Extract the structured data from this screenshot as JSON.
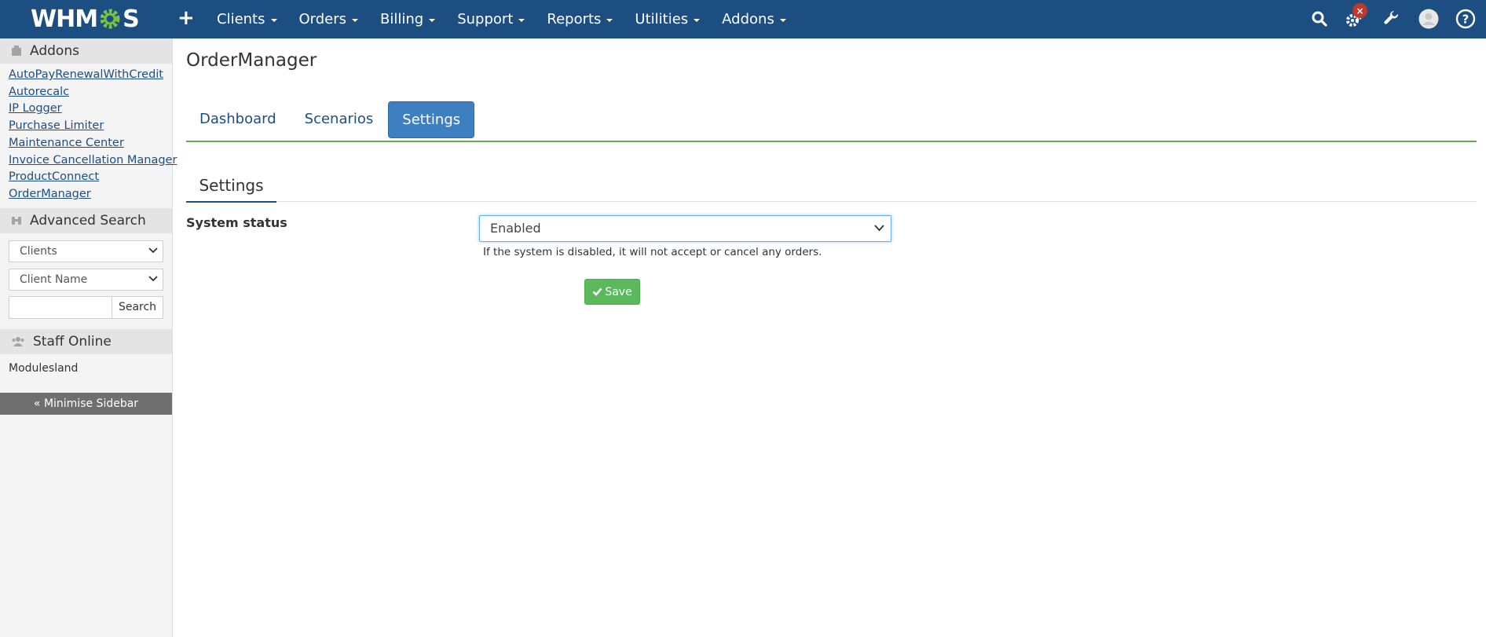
{
  "header": {
    "logo_text": "WHMCS",
    "add_icon": "plus-icon",
    "menu": [
      {
        "label": "Clients"
      },
      {
        "label": "Orders"
      },
      {
        "label": "Billing"
      },
      {
        "label": "Support"
      },
      {
        "label": "Reports"
      },
      {
        "label": "Utilities"
      },
      {
        "label": "Addons"
      }
    ],
    "notification_badge": "×",
    "brand_color": "#1d4e82"
  },
  "sidebar": {
    "addons_title": "Addons",
    "addon_links": [
      "AutoPayRenewalWithCredit",
      "Autorecalc",
      "IP Logger",
      "Purchase Limiter",
      "Maintenance Center",
      "Invoice Cancellation Manager",
      "ProductConnect",
      "OrderManager"
    ],
    "advanced_search_title": "Advanced Search",
    "search_type": "Clients",
    "search_field": "Client Name",
    "search_button": "Search",
    "staff_online_title": "Staff Online",
    "staff": [
      "Modulesland"
    ],
    "minimise_label": "« Minimise Sidebar"
  },
  "main": {
    "page_title": "OrderManager",
    "tabs": [
      {
        "label": "Dashboard"
      },
      {
        "label": "Scenarios"
      },
      {
        "label": "Settings",
        "active": true
      }
    ],
    "section_tab": "Settings",
    "field_label": "System status",
    "status_value": "Enabled",
    "help_text": "If the system is disabled, it will not accept or cancel any orders.",
    "save_label": "Save",
    "accent_green": "#5cb85c",
    "active_tab_color": "#3d7fc1"
  }
}
